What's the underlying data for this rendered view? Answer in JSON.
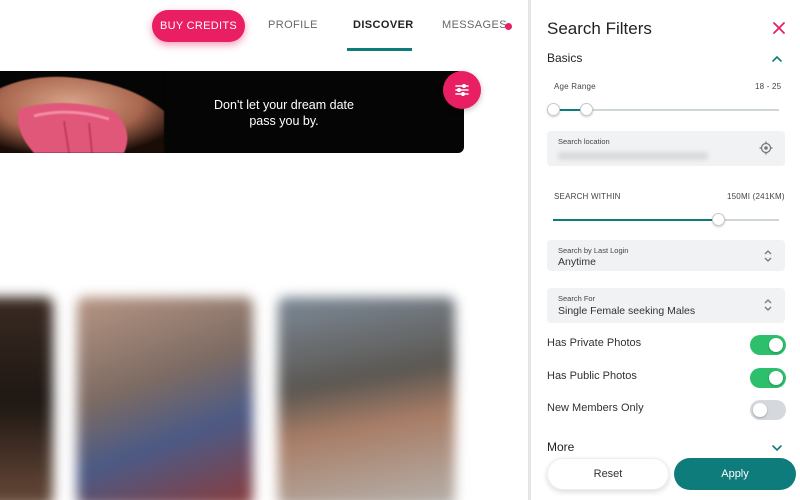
{
  "nav": {
    "buy_credits": "BUY CREDITS",
    "profile": "PROFILE",
    "discover": "DISCOVER",
    "messages": "MESSAGES",
    "active_tab": "DISCOVER",
    "unread_indicator": true
  },
  "banner": {
    "text": "Don't let your dream date pass you by.",
    "filter_icon": "sliders-icon"
  },
  "colors": {
    "accent_pink": "#e91e63",
    "accent_teal": "#0e7c7b",
    "toggle_on": "#2dbf6c",
    "toggle_off": "#d5d8dd"
  },
  "panel": {
    "title": "Search Filters",
    "close_icon": "close-icon",
    "basics": {
      "title": "Basics",
      "expanded": true,
      "age_range": {
        "label": "Age Range",
        "value_text": "18 - 25",
        "min": 18,
        "max": 25
      },
      "location": {
        "label": "Search location",
        "value_obscured": true,
        "locate_icon": "crosshair-icon"
      },
      "search_within": {
        "label": "SEARCH WITHIN",
        "value_text": "150MI (241KM)",
        "fraction": 0.75
      },
      "last_login": {
        "label": "Search by Last Login",
        "value": "Anytime"
      },
      "search_for": {
        "label": "Search For",
        "value": "Single Female seeking Males"
      },
      "toggles": [
        {
          "label": "Has Private Photos",
          "on": true
        },
        {
          "label": "Has Public Photos",
          "on": true
        },
        {
          "label": "New Members Only",
          "on": false
        }
      ]
    },
    "more": {
      "title": "More",
      "expanded": false
    },
    "reset_label": "Reset",
    "apply_label": "Apply"
  }
}
